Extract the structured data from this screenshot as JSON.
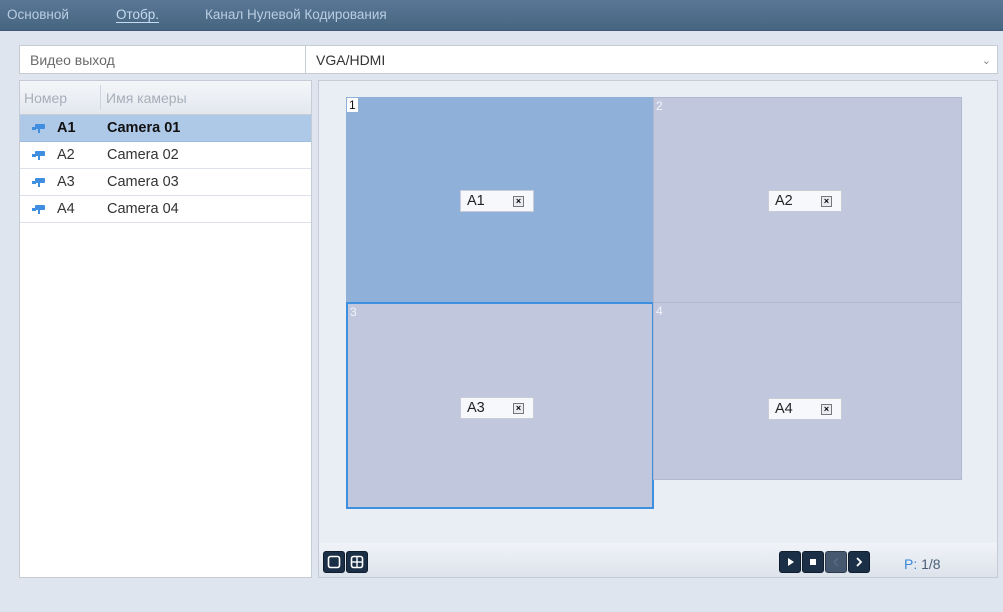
{
  "tabs": [
    {
      "label": "Основной"
    },
    {
      "label": "Отобр."
    },
    {
      "label": "Канал Нулевой Кодирования"
    }
  ],
  "video_output": {
    "label": "Видео выход",
    "value": "VGA/HDMI"
  },
  "camera_list": {
    "columns": [
      "Номер",
      "Имя камеры"
    ],
    "rows": [
      {
        "no": "A1",
        "name": "Camera 01",
        "selected": true
      },
      {
        "no": "A2",
        "name": "Camera 02",
        "selected": false
      },
      {
        "no": "A3",
        "name": "Camera 03",
        "selected": false
      },
      {
        "no": "A4",
        "name": "Camera 04",
        "selected": false
      }
    ]
  },
  "layout": {
    "windows": [
      {
        "number": "1",
        "camera": "A1"
      },
      {
        "number": "2",
        "camera": "A2"
      },
      {
        "number": "3",
        "camera": "A3"
      },
      {
        "number": "4",
        "camera": "A4"
      }
    ]
  },
  "controls": {
    "page_prefix": "P:",
    "page_value": "1/8"
  },
  "colors": {
    "tab_bar": "#4f6e8c",
    "selected_row": "#aec8e8",
    "window_active": "#8fb0d9",
    "window": "#c1c7dc",
    "window_border_selected": "#3d8fe0",
    "control_button": "#1b2f47"
  },
  "icons": {
    "camera": "camera-icon",
    "remove": "close-box-icon",
    "single_view": "single-window-icon",
    "quad_view": "quad-window-icon",
    "play": "play-icon",
    "stop": "stop-icon",
    "prev": "previous-page-icon",
    "next": "next-page-icon"
  }
}
